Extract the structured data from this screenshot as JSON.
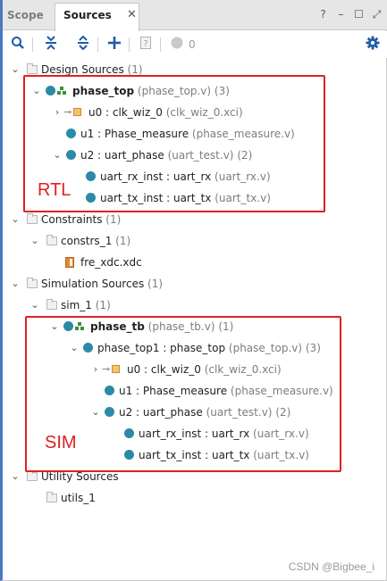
{
  "tabs": {
    "scope": "Scope",
    "sources": "Sources",
    "close": "✕"
  },
  "window_controls": [
    "?",
    "–",
    "☐",
    "⤢"
  ],
  "toolbar": {
    "hide_count": "0"
  },
  "tree": {
    "design_sources": {
      "label": "Design Sources",
      "count": "(1)"
    },
    "phase_top": {
      "name": "phase_top",
      "file": "(phase_top.v)",
      "count": "(3)"
    },
    "u0_clk": {
      "name": "u0 : clk_wiz_0",
      "file": "(clk_wiz_0.xci)"
    },
    "u1_phase": {
      "name": "u1 : Phase_measure",
      "file": "(phase_measure.v)"
    },
    "u2_uart": {
      "name": "u2 : uart_phase",
      "file": "(uart_test.v)",
      "count": "(2)"
    },
    "uart_rx": {
      "name": "uart_rx_inst : uart_rx",
      "file": "(uart_rx.v)"
    },
    "uart_tx": {
      "name": "uart_tx_inst : uart_tx",
      "file": "(uart_tx.v)"
    },
    "constraints": {
      "label": "Constraints",
      "count": "(1)"
    },
    "constrs_1": {
      "label": "constrs_1",
      "count": "(1)"
    },
    "fre_xdc": {
      "label": "fre_xdc.xdc"
    },
    "sim_sources": {
      "label": "Simulation Sources",
      "count": "(1)"
    },
    "sim_1": {
      "label": "sim_1",
      "count": "(1)"
    },
    "phase_tb": {
      "name": "phase_tb",
      "file": "(phase_tb.v)",
      "count": "(1)"
    },
    "phase_top1": {
      "name": "phase_top1 : phase_top",
      "file": "(phase_top.v)",
      "count": "(3)"
    },
    "sim_u0": {
      "name": "u0 : clk_wiz_0",
      "file": "(clk_wiz_0.xci)"
    },
    "sim_u1": {
      "name": "u1 : Phase_measure",
      "file": "(phase_measure.v)"
    },
    "sim_u2": {
      "name": "u2 : uart_phase",
      "file": "(uart_test.v)",
      "count": "(2)"
    },
    "sim_rx": {
      "name": "uart_rx_inst : uart_rx",
      "file": "(uart_rx.v)"
    },
    "sim_tx": {
      "name": "uart_tx_inst : uart_tx",
      "file": "(uart_tx.v)"
    },
    "utility_sources": {
      "label": "Utility Sources"
    },
    "utils_1": {
      "label": "utils_1"
    }
  },
  "annotations": {
    "rtl": "RTL",
    "sim": "SIM"
  },
  "watermark": "CSDN @Bigbee_i",
  "colors": {
    "accent": "#4a78c2",
    "annotation": "#e02020",
    "node": "#2b8aa8"
  }
}
